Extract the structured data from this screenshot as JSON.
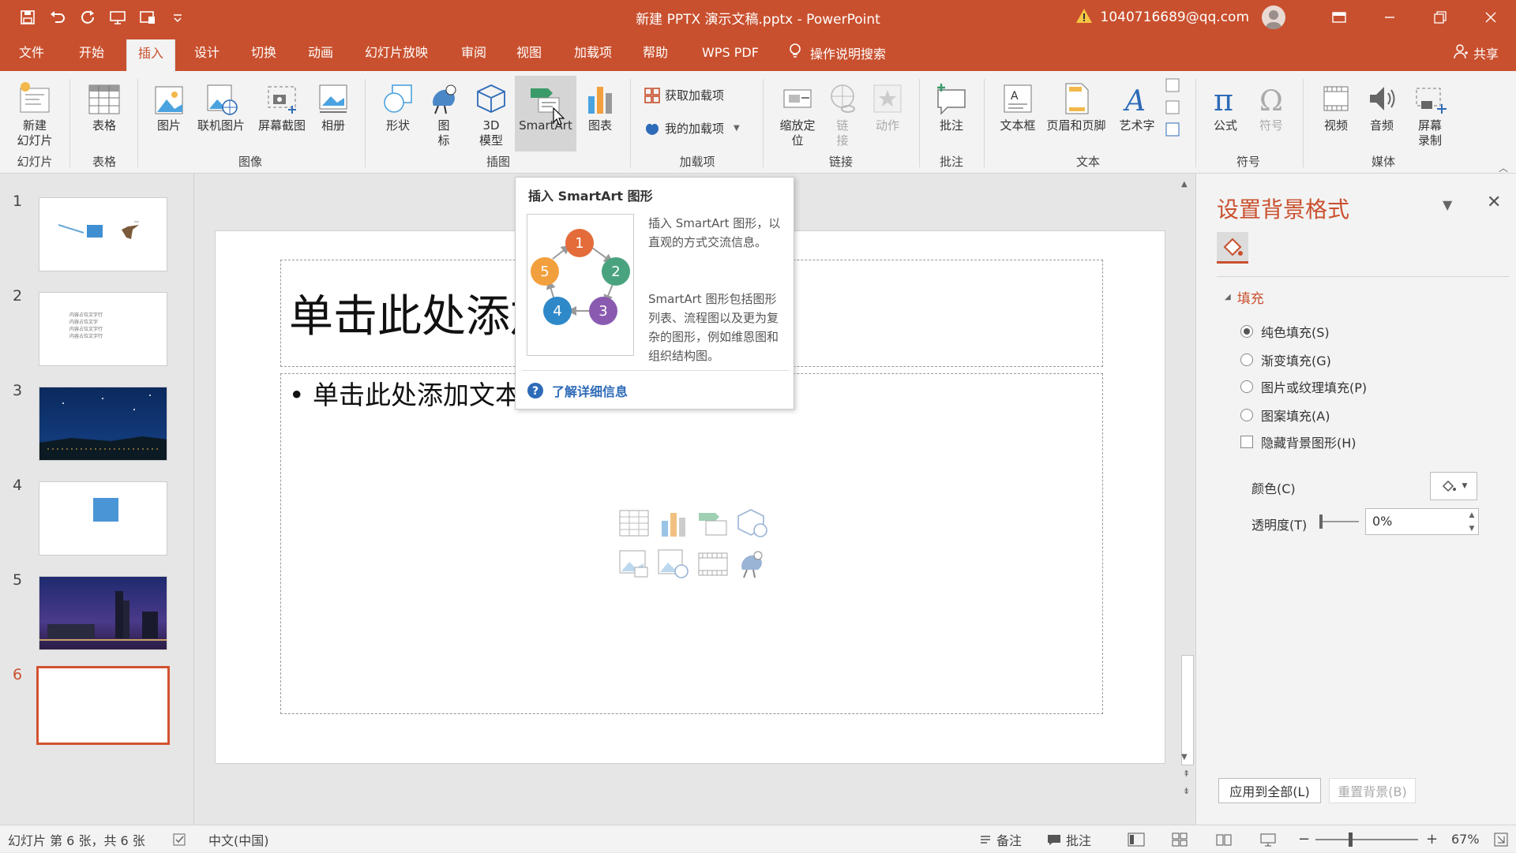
{
  "window": {
    "title": "新建 PPTX 演示文稿.pptx - PowerPoint",
    "account": "1040716689@qq.com",
    "accent_color": "#c9502e"
  },
  "qat": {
    "icons": [
      "save-icon",
      "undo-icon",
      "redo-icon",
      "present-icon",
      "touch-mode-icon",
      "customize-icon"
    ]
  },
  "tabs": [
    "文件",
    "开始",
    "插入",
    "设计",
    "切换",
    "动画",
    "幻灯片放映",
    "审阅",
    "视图",
    "加载项",
    "帮助",
    "WPS PDF"
  ],
  "active_tab": "插入",
  "search_label": "操作说明搜索",
  "share_label": "共享",
  "ribbon": {
    "buttons": {
      "new_slide": "新建\n幻灯片",
      "table": "表格",
      "picture": "图片",
      "online_picture": "联机图片",
      "screenshot": "屏幕截图",
      "album": "相册",
      "shapes": "形状",
      "icons": "图\n标",
      "model3d": "3D\n模型",
      "smartart": "SmartArt",
      "chart": "图表",
      "get_addins": "获取加载项",
      "my_addins": "我的加载项",
      "zoom": "缩放定\n位",
      "link": "链\n接",
      "action": "动作",
      "comment": "批注",
      "textbox": "文本框",
      "header_footer": "页眉和页脚",
      "wordart": "艺术字",
      "equation": "公式",
      "symbol": "符号",
      "video": "视频",
      "audio": "音频",
      "screen_record": "屏幕\n录制"
    },
    "groups": [
      "幻灯片",
      "表格",
      "图像",
      "插图",
      "加载项",
      "链接",
      "批注",
      "文本",
      "符号",
      "媒体"
    ]
  },
  "slides": [
    {
      "number": "1"
    },
    {
      "number": "2",
      "text_lines": [
        "内容占位文字行",
        "内容占位文字",
        "内容占位文字行",
        "内容占位文字行"
      ]
    },
    {
      "number": "3"
    },
    {
      "number": "4"
    },
    {
      "number": "5"
    },
    {
      "number": "6"
    }
  ],
  "slide": {
    "title_placeholder": "单击此处添加标题",
    "body_placeholder": "• 单击此处添加文本"
  },
  "tooltip": {
    "title": "插入 SmartArt 图形",
    "desc1": "插入 SmartArt 图形，以直观的方式交流信息。",
    "desc2": "SmartArt 图形包括图形列表、流程图以及更为复杂的图形，例如维恩图和组织结构图。",
    "link": "了解详细信息",
    "cycle_numbers": [
      "1",
      "2",
      "3",
      "4",
      "5"
    ]
  },
  "format_pane": {
    "title": "设置背景格式",
    "section": "填充",
    "options": [
      {
        "label": "纯色填充(S)",
        "checked": true
      },
      {
        "label": "渐变填充(G)",
        "checked": false
      },
      {
        "label": "图片或纹理填充(P)",
        "checked": false
      },
      {
        "label": "图案填充(A)",
        "checked": false
      }
    ],
    "hide_bg": "隐藏背景图形(H)",
    "color_label": "颜色(C)",
    "transparency_label": "透明度(T)",
    "transparency_value": "0%",
    "apply_all": "应用到全部(L)",
    "reset_bg": "重置背景(B)"
  },
  "status": {
    "slide_info": "幻灯片 第 6 张，共 6 张",
    "language": "中文(中国)",
    "notes": "备注",
    "comments": "批注",
    "zoom": "67%"
  }
}
